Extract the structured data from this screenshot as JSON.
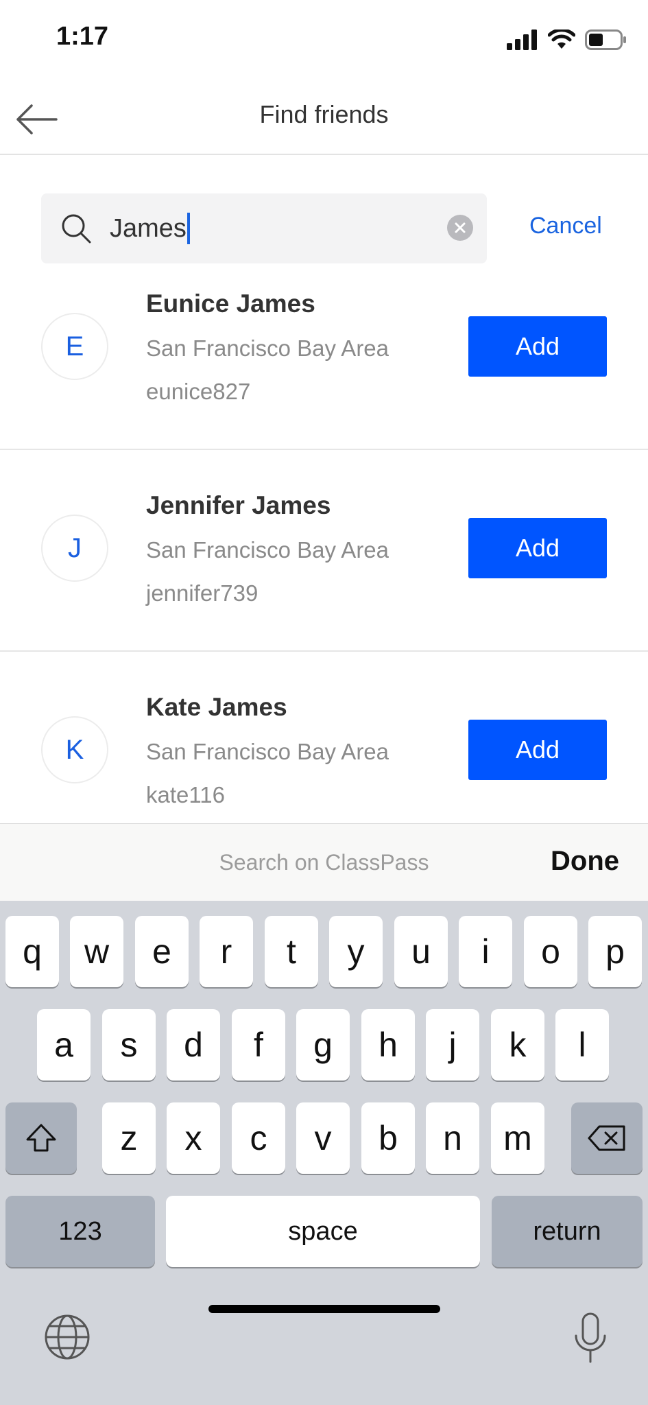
{
  "status_bar": {
    "time": "1:17"
  },
  "header": {
    "title": "Find friends"
  },
  "search": {
    "value": "James",
    "cancel_label": "Cancel"
  },
  "results": [
    {
      "initial": "E",
      "name": "Eunice James",
      "location": "San Francisco Bay Area",
      "username": "eunice827",
      "action": "Add"
    },
    {
      "initial": "J",
      "name": "Jennifer James",
      "location": "San Francisco Bay Area",
      "username": "jennifer739",
      "action": "Add"
    },
    {
      "initial": "K",
      "name": "Kate James",
      "location": "San Francisco Bay Area",
      "username": "kate116",
      "action": "Add"
    }
  ],
  "keyboard_accessory": {
    "search_label": "Search on ClassPass",
    "done_label": "Done"
  },
  "keyboard": {
    "row1": [
      "q",
      "w",
      "e",
      "r",
      "t",
      "y",
      "u",
      "i",
      "o",
      "p"
    ],
    "row2": [
      "a",
      "s",
      "d",
      "f",
      "g",
      "h",
      "j",
      "k",
      "l"
    ],
    "row3": [
      "z",
      "x",
      "c",
      "v",
      "b",
      "n",
      "m"
    ],
    "numbers_label": "123",
    "space_label": "space",
    "return_label": "return"
  },
  "colors": {
    "accent": "#0055ff",
    "link": "#1a64e0"
  }
}
